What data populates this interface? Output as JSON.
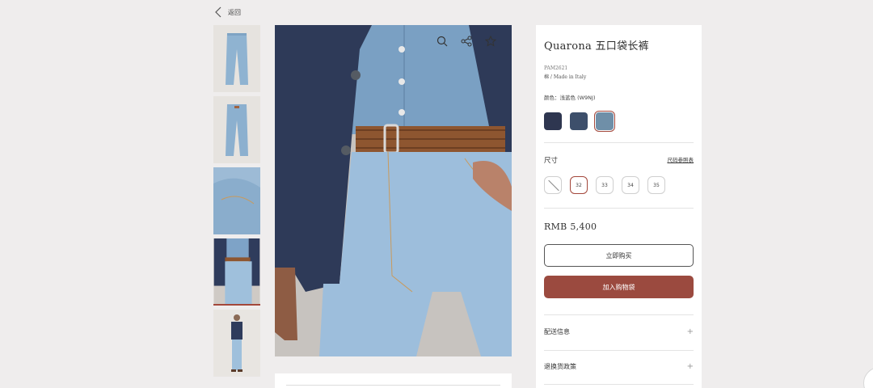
{
  "nav": {
    "back_label": "返回"
  },
  "thumbnails": [
    {
      "label": "jeans-front"
    },
    {
      "label": "jeans-back"
    },
    {
      "label": "jeans-detail"
    },
    {
      "label": "model-waist",
      "active": true
    },
    {
      "label": "model-full"
    }
  ],
  "main_image": {
    "label": "model-waist-closeup"
  },
  "product": {
    "title": "Quarona 五口袋长裤",
    "code": "PAM2621",
    "material": "棉 / Made in Italy",
    "color_label": "颜色：浅蓝色 (W9NJ)",
    "swatches": [
      {
        "color": "#2e3650"
      },
      {
        "color": "#3d4f6b"
      },
      {
        "color": "#6f8fa8",
        "selected": true
      }
    ],
    "size_label": "尺寸",
    "size_guide": "尺码参照表",
    "sizes": [
      {
        "label": "",
        "unavailable": true
      },
      {
        "label": "32",
        "selected": true
      },
      {
        "label": "33"
      },
      {
        "label": "34"
      },
      {
        "label": "35"
      }
    ],
    "price": "RMB 5,400",
    "buy_now": "立即购买",
    "add_to_bag": "加入购物袋",
    "accordions": [
      {
        "label": "配送信息"
      },
      {
        "label": "退换货政策"
      }
    ]
  },
  "colors": {
    "accent": "#9b4a3f",
    "background": "#efeded"
  }
}
